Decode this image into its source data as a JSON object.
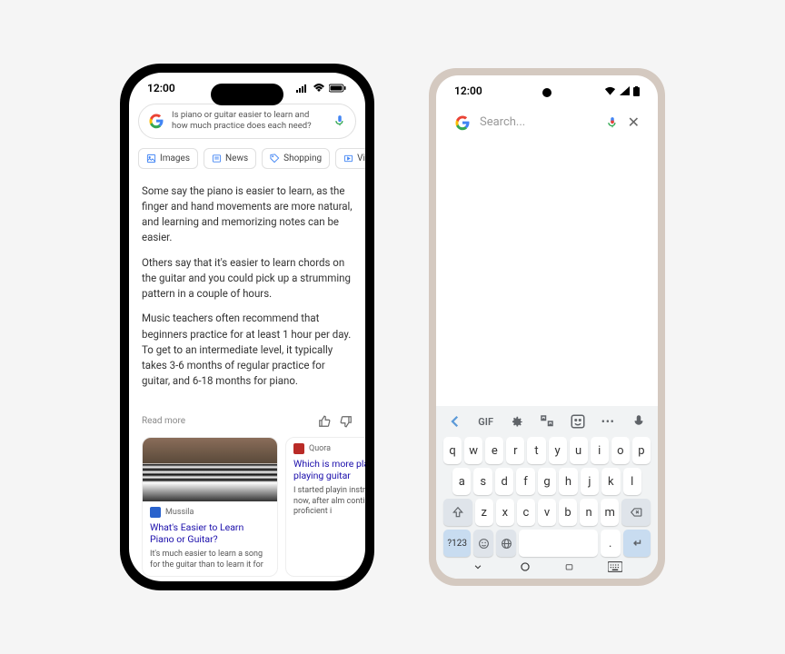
{
  "ios": {
    "time": "12:00",
    "search_query": "Is piano or guitar easier to learn and how much practice does each need?",
    "chips": [
      "Images",
      "News",
      "Shopping",
      "Vide"
    ],
    "paragraphs": [
      "Some say the piano is easier to learn, as the finger and hand movements are more natural, and learning and memorizing notes can be easier.",
      "Others say that it's easier to learn chords on the guitar and you could pick up a strumming pattern in a couple of hours.",
      "Music teachers often recommend that beginners practice for at least 1 hour per day. To get to an intermediate level, it typically takes 3-6 months of regular practice for guitar, and 6-18 months for piano."
    ],
    "read_more": "Read more",
    "cards": [
      {
        "source": "Mussila",
        "title": "What's Easier to Learn Piano or Guitar?",
        "snippet": "It's much easier to learn a song for the guitar than to learn it for"
      },
      {
        "source": "Quora",
        "title": "Which is more playing piano playing guitar",
        "snippet": "I started playin instruments th now, after alm continue to d proficient i"
      }
    ]
  },
  "android": {
    "time": "12:00",
    "search_placeholder": "Search...",
    "keyboard": {
      "toolbar_gif": "GIF",
      "row1": [
        "q",
        "w",
        "e",
        "r",
        "t",
        "y",
        "u",
        "i",
        "o",
        "p"
      ],
      "row2": [
        "a",
        "s",
        "d",
        "f",
        "g",
        "h",
        "j",
        "k",
        "l"
      ],
      "row3": [
        "z",
        "x",
        "c",
        "v",
        "b",
        "n",
        "m"
      ],
      "numkey": "?123",
      "comma": ",",
      "period": "."
    }
  }
}
